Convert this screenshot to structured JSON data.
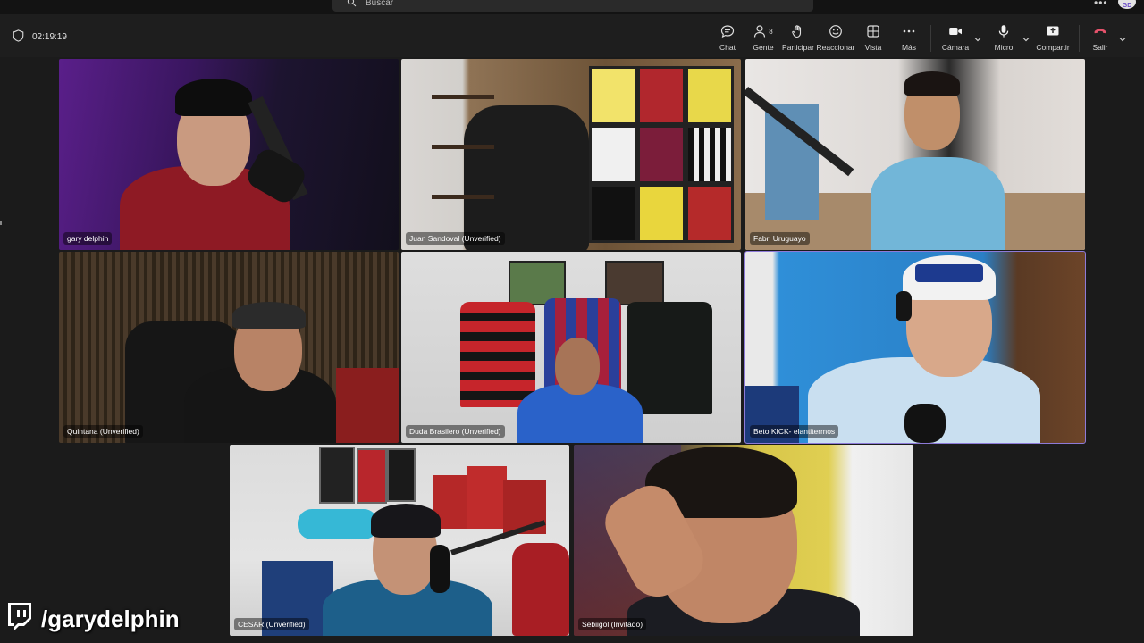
{
  "search": {
    "placeholder": "Buscar"
  },
  "account": {
    "initials": "GD"
  },
  "meeting": {
    "elapsed": "02:19:19"
  },
  "toolbar": {
    "chat": "Chat",
    "people": "Gente",
    "people_count": "8",
    "raise_hand": "Participar",
    "react": "Reaccionar",
    "view": "Vista",
    "more": "Más",
    "camera": "Cámara",
    "mic": "Micro",
    "share": "Compartir",
    "leave": "Salir"
  },
  "participants": [
    {
      "name": "gary delphin"
    },
    {
      "name": "Juan Sandoval (Unverified)"
    },
    {
      "name": "Fabri Uruguayo"
    },
    {
      "name": "Quintana (Unverified)"
    },
    {
      "name": "Duda Brasilero (Unverified)"
    },
    {
      "name": "Beto KICK- elantitermos"
    },
    {
      "name": "CESAR (Unverified)"
    },
    {
      "name": "Sebiigol (Invitado)"
    }
  ],
  "overlay": {
    "twitch_handle": "/garydelphin"
  },
  "colors": {
    "accent": "#8d7ad8",
    "leave": "#e5526b",
    "background": "#1b1b1b"
  }
}
